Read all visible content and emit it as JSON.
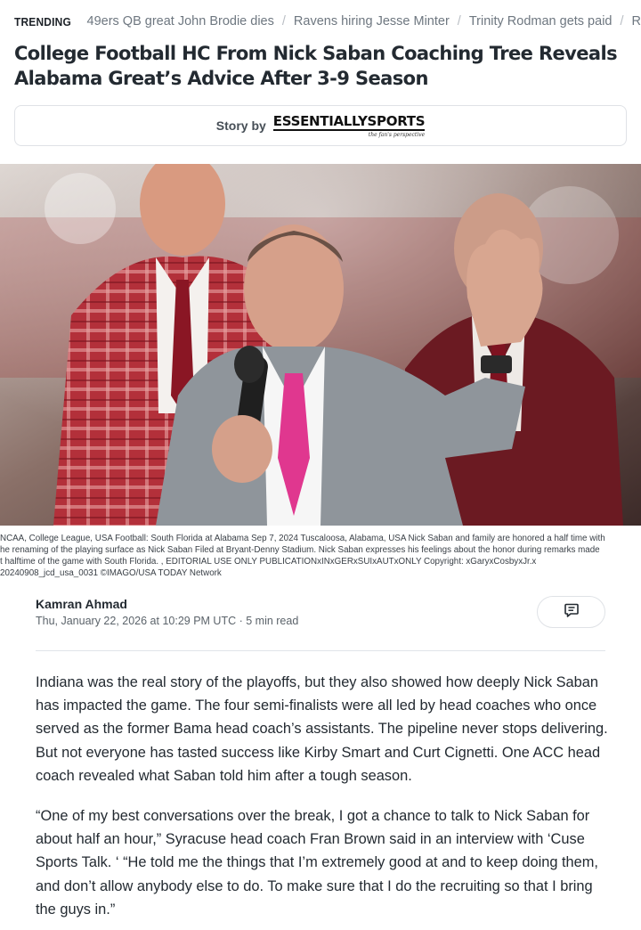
{
  "trending": {
    "label": "TRENDING",
    "items": [
      "49ers QB great John Brodie dies",
      "Ravens hiring Jesse Minter",
      "Trinity Rodman gets paid",
      "Rep"
    ]
  },
  "article": {
    "headline": "College Football HC From Nick Saban Coaching Tree Reveals Alabama Great’s Advice After 3-9 Season",
    "story_by_label": "Story by",
    "publisher_logo_text": "ESSENTIALLYSPORTS",
    "publisher_tagline": "the fan's perspective",
    "caption": "NCAA, College League, USA Football: South Florida at Alabama Sep 7, 2024 Tuscaloosa, Alabama, USA Nick Saban and family are honored a half time with\nhe renaming of the playing surface as Nick Saban Filed at Bryant-Denny Stadium. Nick Saban expresses his feelings about the honor during remarks made\nt halftime of the game with South Florida. , EDITORIAL USE ONLY PUBLICATIONxINxGERxSUIxAUTxONLY Copyright: xGaryxCosbyxJr.x\n20240908_jcd_usa_0031 ©IMAGO/USA TODAY Network",
    "author": "Kamran Ahmad",
    "meta": "Thu, January 22, 2026 at 10:29 PM UTC · 5 min read",
    "comment_icon": "comment-icon",
    "paragraphs": [
      "Indiana was the real story of the playoffs, but they also showed how deeply Nick Saban has impacted the game. The four semi-finalists were all led by head coaches who once served as the former Bama head coach’s assistants. The pipeline never stops delivering. But not everyone has tasted success like Kirby Smart and Curt Cignetti. One ACC head coach revealed what Saban told him after a tough season.",
      "“One of my best conversations over the break, I got a chance to talk to Nick Saban for about half an hour,” Syracuse head coach Fran Brown said in an interview with ‘Cuse Sports Talk. ‘ “He told me the things that I’m extremely good at and to keep doing them, and don’t allow anybody else to do. To make sure that I do the recruiting so that I bring the guys in.”"
    ]
  },
  "colors": {
    "text": "#232a31",
    "muted": "#6e7780",
    "border": "#dfe2e6",
    "crimson": "#9e1b32"
  }
}
